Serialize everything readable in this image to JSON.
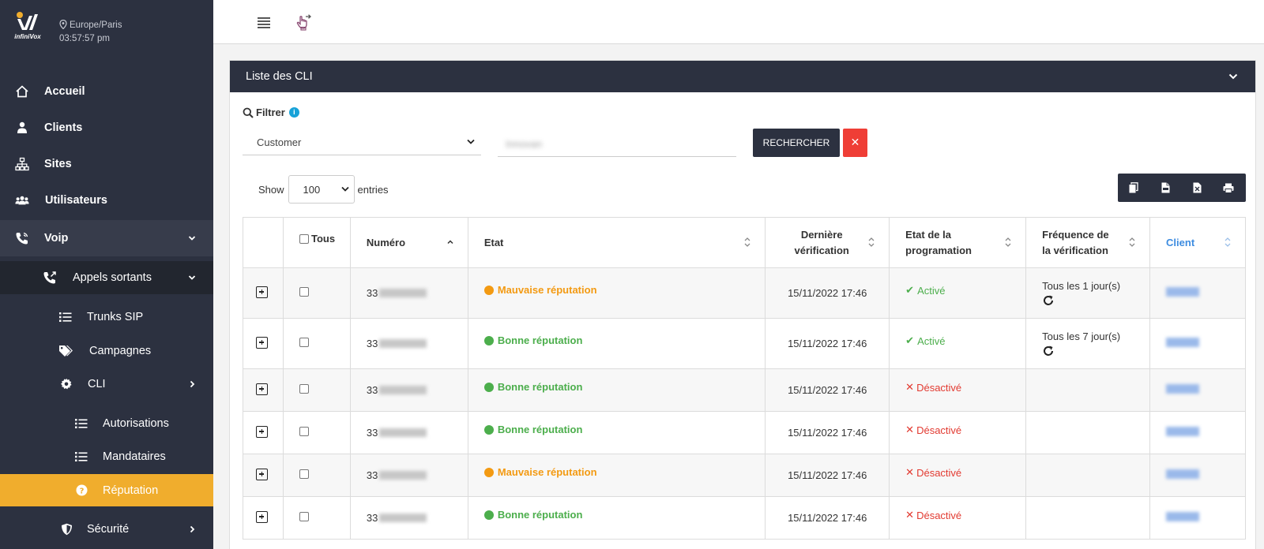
{
  "brand": {
    "name": "infiniVox",
    "accent": "#f0ad2d",
    "dark": "#2c3140"
  },
  "timezone": {
    "zone": "Europe/Paris",
    "time": "03:57:57 pm"
  },
  "nav": {
    "accueil": "Accueil",
    "clients": "Clients",
    "sites": "Sites",
    "utilisateurs": "Utilisateurs",
    "voip": "Voip",
    "appels": "Appels sortants",
    "trunks": "Trunks SIP",
    "campagnes": "Campagnes",
    "cli": "CLI",
    "autorisations": "Autorisations",
    "mandataires": "Mandataires",
    "reputation": "Réputation",
    "securite": "Sécurité"
  },
  "card": {
    "title": "Liste des CLI"
  },
  "filter": {
    "label": "Filtrer",
    "field": "Customer",
    "value": "Innovan",
    "search_label": "RECHERCHER"
  },
  "entries": {
    "show": "Show",
    "value": "100",
    "suffix": "entries"
  },
  "table": {
    "headers": {
      "tous": "Tous",
      "numero": "Numéro",
      "etat": "Etat",
      "derniere": "Dernière vérification",
      "etat_prog": "Etat de la programation",
      "frequence": "Fréquence de la vérification",
      "client": "Client"
    },
    "rows": [
      {
        "numero": "33",
        "etat": "Mauvaise réputation",
        "date": "15/11/2022 17:46",
        "prog": "Activé",
        "freq": "Tous les 1 jour(s)"
      },
      {
        "numero": "33",
        "etat": "Bonne réputation",
        "date": "15/11/2022 17:46",
        "prog": "Activé",
        "freq": "Tous les 7 jour(s)"
      },
      {
        "numero": "33",
        "etat": "Bonne réputation",
        "date": "15/11/2022 17:46",
        "prog": "Désactivé",
        "freq": ""
      },
      {
        "numero": "33",
        "etat": "Bonne réputation",
        "date": "15/11/2022 17:46",
        "prog": "Désactivé",
        "freq": ""
      },
      {
        "numero": "33",
        "etat": "Mauvaise réputation",
        "date": "15/11/2022 17:46",
        "prog": "Désactivé",
        "freq": ""
      },
      {
        "numero": "33",
        "etat": "Bonne réputation",
        "date": "15/11/2022 17:46",
        "prog": "Désactivé",
        "freq": ""
      }
    ]
  }
}
